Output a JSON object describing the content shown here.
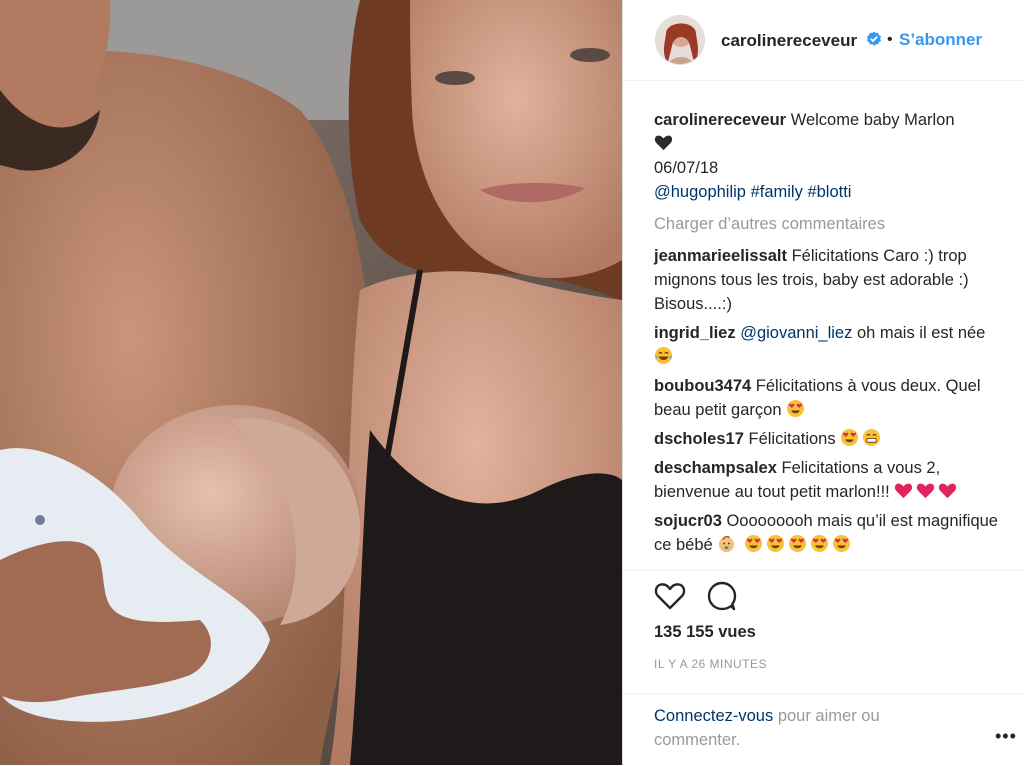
{
  "post": {
    "username": "carolinereceveur",
    "follow_label": "S’abonner",
    "separator": "•"
  },
  "caption": {
    "username": "carolinereceveur",
    "text": "Welcome baby Marlon",
    "date": "06/07/18",
    "mention": "@hugophilip",
    "tag1": "#family",
    "tag2": "#blotti"
  },
  "load_more": "Charger d’autres commentaires",
  "comments": [
    {
      "user": "jeanmarieelissalt",
      "text": "Félicitations Caro :) trop mignons tous les trois, baby est adorable :) Bisous....:)"
    },
    {
      "user": "ingrid_liez",
      "mention": "@giovanni_liez",
      "text": "oh mais il est née"
    },
    {
      "user": "boubou3474",
      "text": "Félicitations à vous deux. Quel beau petit garçon"
    },
    {
      "user": "dscholes17",
      "text": "Félicitations"
    },
    {
      "user": "deschampsalex",
      "text": "Felicitations a vous 2, bienvenue au tout petit marlon!!!"
    },
    {
      "user": "sojucr03",
      "text": "Ooooooooh mais qu’il est magnifique ce bébé"
    }
  ],
  "stats": {
    "views": "135 155 vues",
    "time": "IL Y A 26 MINUTES"
  },
  "login": {
    "link": "Connectez-vous",
    "text": "pour aimer ou commenter.",
    "more": "•••"
  },
  "icons": {
    "like": "heart-outline-icon",
    "comment": "speech-bubble-icon",
    "verified": "verified-badge-icon"
  },
  "colors": {
    "link_blue": "#3897f0",
    "tag_blue": "#003569",
    "muted": "#999999"
  }
}
